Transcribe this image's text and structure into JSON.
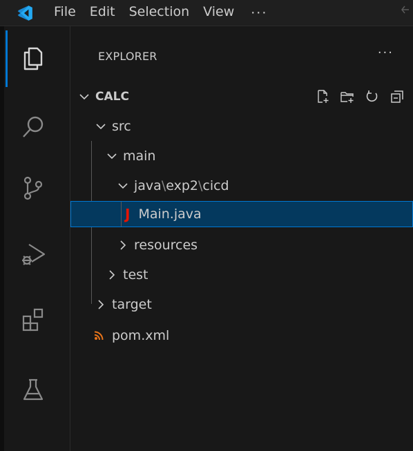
{
  "menu": {
    "items": [
      "File",
      "Edit",
      "Selection",
      "View"
    ],
    "more": "···"
  },
  "explorer": {
    "title": "EXPLORER",
    "more": "···"
  },
  "tree": {
    "root": "CALC",
    "src": "src",
    "main": "main",
    "java_path": {
      "part1": "java",
      "part2": "exp2",
      "part3": "cicd",
      "separator": "\\"
    },
    "main_java": "Main.java",
    "java_icon_letter": "J",
    "resources": "resources",
    "test": "test",
    "target": "target",
    "pom": "pom.xml"
  },
  "colors": {
    "accent": "#0078d4",
    "selection": "#04395e",
    "java": "#e51400",
    "rss": "#e8741a",
    "logo": "#23a9f2"
  }
}
